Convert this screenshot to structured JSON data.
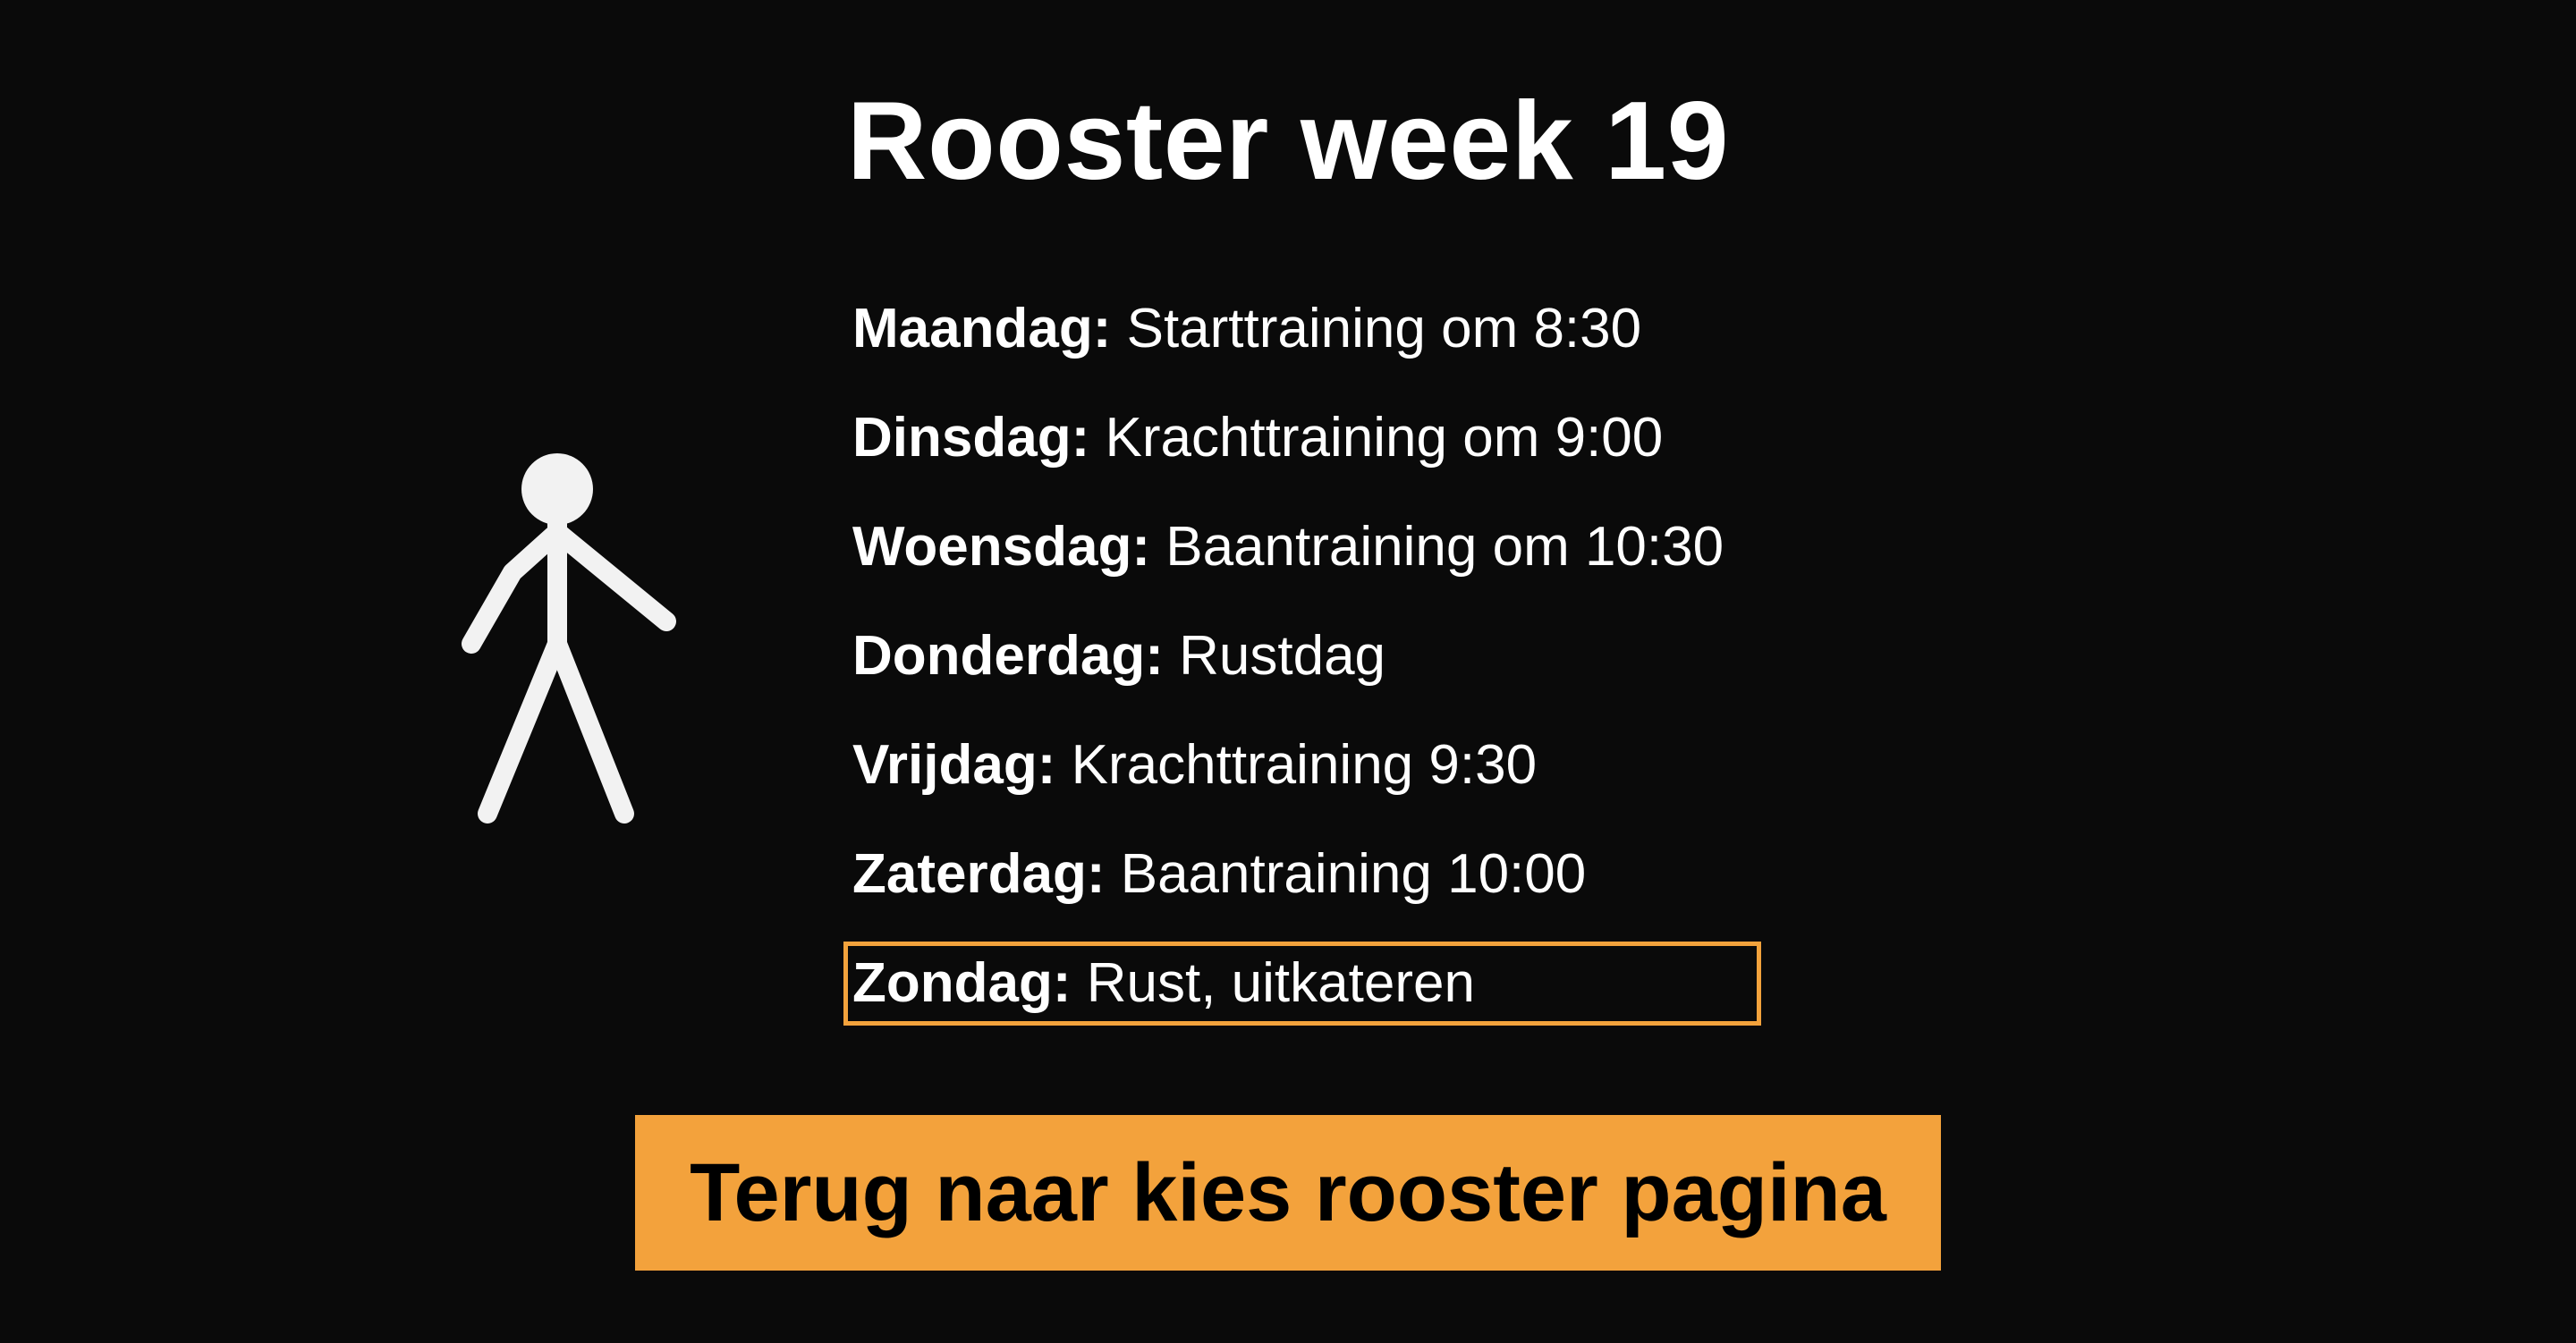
{
  "page": {
    "title": "Rooster week 19"
  },
  "schedule": {
    "items": [
      {
        "day": "Maandag:",
        "activity": "Starttraining om 8:30"
      },
      {
        "day": "Dinsdag:",
        "activity": "Krachttraining om 9:00"
      },
      {
        "day": "Woensdag:",
        "activity": "Baantraining om 10:30"
      },
      {
        "day": "Donderdag:",
        "activity": "Rustdag"
      },
      {
        "day": "Vrijdag:",
        "activity": "Krachttraining 9:30"
      },
      {
        "day": "Zaterdag:",
        "activity": "Baantraining 10:00"
      },
      {
        "day": "Zondag:",
        "activity": "Rust, uitkateren"
      }
    ]
  },
  "back_button": {
    "label": "Terug naar kies rooster pagina"
  },
  "icons": {
    "figure": "stick-figure-icon"
  },
  "colors": {
    "background": "#0a0a0a",
    "text": "#ffffff",
    "accent": "#f3a23c",
    "button_text": "#000000"
  }
}
